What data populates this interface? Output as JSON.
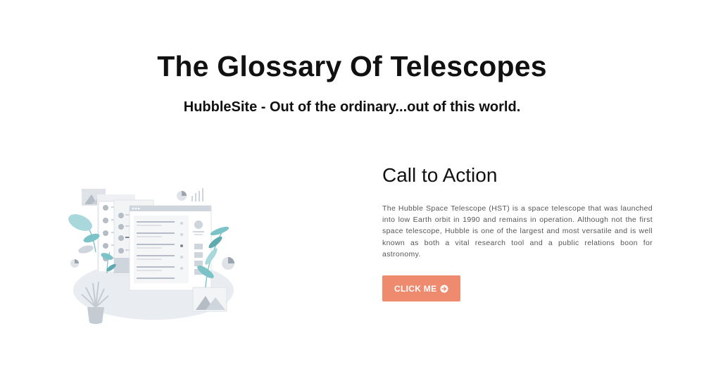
{
  "header": {
    "title": "The Glossary Of Telescopes",
    "subtitle": "HubbleSite - Out of the ordinary...out of this world."
  },
  "cta": {
    "heading": "Call to Action",
    "body": "The Hubble Space Telescope (HST) is a space telescope that was launched into low Earth orbit in 1990 and remains in operation. Although not the first space telescope, Hubble is one of the largest and most versatile and is well known as both a vital research tool and a public relations boon for astronomy.",
    "button_label": "CLICK ME",
    "button_icon": "arrow-circle-right-icon"
  },
  "illustration": {
    "icon": "dashboard-illustration"
  },
  "colors": {
    "accent": "#ee8a6e",
    "teal": "#7cc3c8",
    "grey": "#cfd5dc",
    "light": "#e9ecf0"
  }
}
